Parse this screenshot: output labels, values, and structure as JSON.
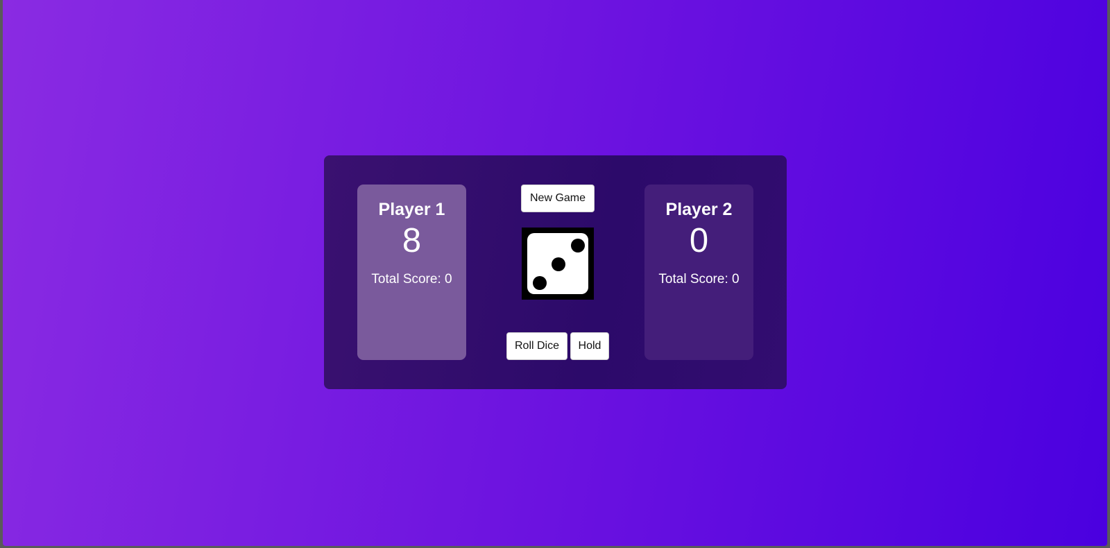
{
  "controls": {
    "new_game_label": "New Game",
    "roll_label": "Roll Dice",
    "hold_label": "Hold"
  },
  "players": [
    {
      "name": "Player 1",
      "current_score": "8",
      "total_score": "Total Score: 0",
      "active": true
    },
    {
      "name": "Player 2",
      "current_score": "0",
      "total_score": "Total Score: 0",
      "active": false
    }
  ],
  "dice": {
    "value": 3,
    "icon": "dice-three-icon"
  },
  "colors": {
    "background_start": "#8a2be2",
    "background_end": "#4a00e0",
    "board": "#2c0a6a",
    "active_player_panel": "#7a5a9c",
    "inactive_player_panel": "#441e7a"
  }
}
